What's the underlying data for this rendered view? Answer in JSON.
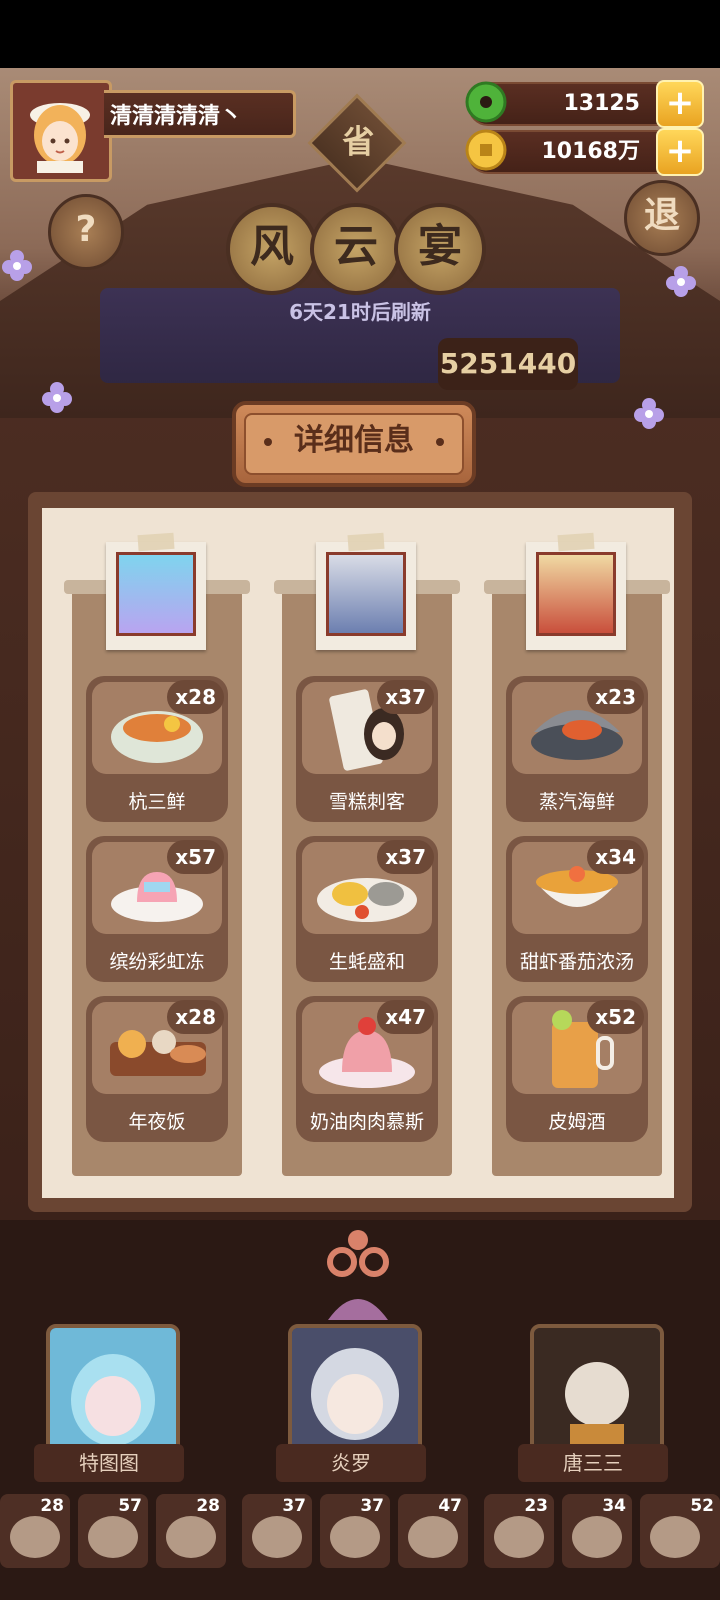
{
  "player": {
    "name": "清清清清清丶"
  },
  "currency": {
    "jade": "13125",
    "coins": "10168万"
  },
  "buttons": {
    "help": "?",
    "exit": "退",
    "province": "省"
  },
  "title": [
    "风",
    "云",
    "宴"
  ],
  "refresh_text": "6天21时后刷新",
  "score": "5251440",
  "panel_title": "详细信息",
  "columns": [
    {
      "dishes": [
        {
          "name": "杭三鲜",
          "count": "x28"
        },
        {
          "name": "缤纷彩虹冻",
          "count": "x57"
        },
        {
          "name": "年夜饭",
          "count": "x28"
        }
      ]
    },
    {
      "dishes": [
        {
          "name": "雪糕刺客",
          "count": "x37"
        },
        {
          "name": "生蚝盛和",
          "count": "x37"
        },
        {
          "name": "奶油肉肉慕斯",
          "count": "x47"
        }
      ]
    },
    {
      "dishes": [
        {
          "name": "蒸汽海鲜",
          "count": "x23"
        },
        {
          "name": "甜虾番茄浓汤",
          "count": "x34"
        },
        {
          "name": "皮姆酒",
          "count": "x52"
        }
      ]
    }
  ],
  "characters": [
    "特图图",
    "炎罗",
    "唐三三"
  ],
  "bottom_counts": [
    "28",
    "57",
    "28",
    "37",
    "37",
    "47",
    "23",
    "34",
    "52"
  ],
  "colors": {
    "gold": "#e9a321",
    "wood": "#6a4533",
    "paper": "#efe3d3",
    "card": "#7a5643"
  }
}
